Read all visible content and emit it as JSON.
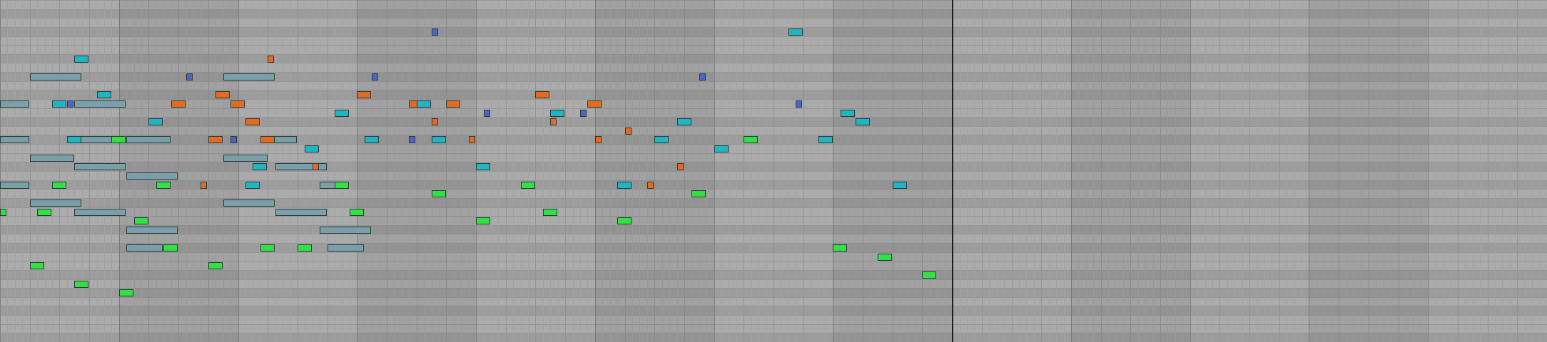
{
  "app": {
    "view": "piano-roll-note-editor",
    "total_steps": 208,
    "total_rows": 38,
    "playhead_step": 128,
    "bar_steps": 16
  },
  "colors": {
    "background_white_key": "#ababab",
    "background_black_key": "#9c9c9c",
    "grid_line_step": "#a2a2a2",
    "grid_line_beat": "#939393",
    "grid_line_bar": "#7f7f7f",
    "playhead": "#1e1e1e",
    "note_border": "#2b3a3c",
    "note_types": {
      "slate": "#7a9fa8",
      "orange": "#e56a1f",
      "teal": "#1fb5c2",
      "green": "#31e043",
      "blue": "#4b66c6"
    }
  },
  "note_blocks": [
    {
      "name": "pad-note-run",
      "type": "slate",
      "notes": [
        [
          0,
          11,
          4
        ],
        [
          4,
          8,
          7
        ],
        [
          10,
          11,
          7
        ],
        [
          0,
          15,
          4
        ],
        [
          10,
          15,
          6
        ],
        [
          17,
          15,
          6
        ],
        [
          4,
          17,
          6
        ],
        [
          10,
          18,
          7
        ],
        [
          17,
          19,
          7
        ],
        [
          0,
          20,
          4
        ],
        [
          4,
          22,
          7
        ],
        [
          10,
          23,
          7
        ],
        [
          17,
          25,
          7
        ],
        [
          30,
          8,
          7
        ],
        [
          36,
          15,
          4
        ],
        [
          30,
          17,
          6
        ],
        [
          37,
          18,
          7
        ],
        [
          43,
          20,
          4
        ],
        [
          30,
          22,
          7
        ],
        [
          37,
          23,
          7
        ],
        [
          43,
          25,
          7
        ],
        [
          17,
          27,
          5
        ],
        [
          44,
          27,
          5
        ]
      ]
    },
    {
      "name": "accent-note-run",
      "type": "orange",
      "notes": [
        [
          29,
          10,
          2
        ],
        [
          23,
          11,
          2
        ],
        [
          31,
          11,
          2
        ],
        [
          33,
          13,
          2
        ],
        [
          28,
          15,
          2
        ],
        [
          35,
          15,
          2
        ],
        [
          42,
          18,
          1
        ],
        [
          27,
          20,
          1
        ],
        [
          36,
          6,
          1
        ],
        [
          48,
          10,
          2
        ],
        [
          55,
          11,
          2
        ],
        [
          60,
          11,
          2
        ],
        [
          58,
          13,
          1
        ],
        [
          63,
          15,
          1
        ],
        [
          72,
          10,
          2
        ],
        [
          79,
          11,
          2
        ],
        [
          74,
          13,
          1
        ],
        [
          80,
          15,
          1
        ],
        [
          84,
          14,
          1
        ],
        [
          91,
          18,
          1
        ],
        [
          87,
          20,
          1
        ]
      ]
    },
    {
      "name": "lead-note-run",
      "type": "teal",
      "notes": [
        [
          10,
          6,
          2
        ],
        [
          13,
          10,
          2
        ],
        [
          7,
          11,
          2
        ],
        [
          20,
          13,
          2
        ],
        [
          9,
          15,
          2
        ],
        [
          33,
          20,
          2
        ],
        [
          41,
          16,
          2
        ],
        [
          34,
          18,
          2
        ],
        [
          45,
          12,
          2
        ],
        [
          56,
          11,
          2
        ],
        [
          49,
          15,
          2
        ],
        [
          58,
          15,
          2
        ],
        [
          64,
          18,
          2
        ],
        [
          74,
          12,
          2
        ],
        [
          83,
          20,
          2
        ],
        [
          88,
          15,
          2
        ],
        [
          96,
          16,
          2
        ],
        [
          91,
          13,
          2
        ],
        [
          106,
          3,
          2
        ],
        [
          110,
          15,
          2
        ],
        [
          113,
          12,
          2
        ],
        [
          115,
          13,
          2
        ],
        [
          120,
          20,
          2
        ]
      ]
    },
    {
      "name": "bass-note-run",
      "type": "green",
      "notes": [
        [
          15,
          15,
          2
        ],
        [
          7,
          20,
          2
        ],
        [
          21,
          20,
          2
        ],
        [
          5,
          23,
          2
        ],
        [
          0,
          23,
          1
        ],
        [
          18,
          24,
          2
        ],
        [
          22,
          27,
          2
        ],
        [
          4,
          29,
          2
        ],
        [
          10,
          31,
          2
        ],
        [
          16,
          32,
          2
        ],
        [
          28,
          29,
          2
        ],
        [
          35,
          27,
          2
        ],
        [
          40,
          27,
          2
        ],
        [
          45,
          20,
          2
        ],
        [
          47,
          23,
          2
        ],
        [
          58,
          21,
          2
        ],
        [
          64,
          24,
          2
        ],
        [
          70,
          20,
          2
        ],
        [
          73,
          23,
          2
        ],
        [
          83,
          24,
          2
        ],
        [
          93,
          21,
          2
        ],
        [
          100,
          15,
          2
        ],
        [
          112,
          27,
          2
        ],
        [
          118,
          28,
          2
        ],
        [
          124,
          30,
          2
        ]
      ]
    },
    {
      "name": "marker-note-run",
      "type": "blue",
      "notes": [
        [
          9,
          11,
          1
        ],
        [
          25,
          8,
          1
        ],
        [
          31,
          15,
          1
        ],
        [
          50,
          8,
          1
        ],
        [
          58,
          3,
          1
        ],
        [
          55,
          15,
          1
        ],
        [
          65,
          12,
          1
        ],
        [
          78,
          12,
          1
        ],
        [
          94,
          8,
          1
        ],
        [
          107,
          11,
          1
        ]
      ]
    }
  ]
}
